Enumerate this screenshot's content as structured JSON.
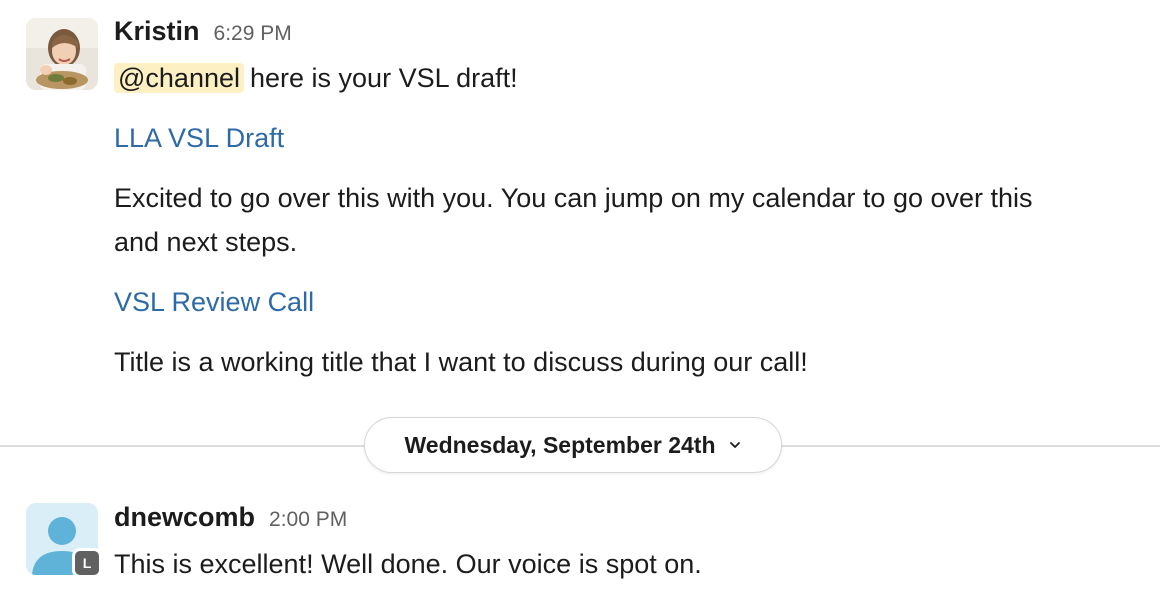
{
  "messages": [
    {
      "author": "Kristin",
      "time": "6:29 PM",
      "mention": "@channel",
      "intro": "here is your VSL draft!",
      "link1": "LLA VSL Draft",
      "body_line1": "Excited to go over this with you. You can jump on my calendar to go over this",
      "body_line2": "and next steps.",
      "link2": "VSL Review Call",
      "closing": "Title is a working title that I want to discuss during our call!"
    },
    {
      "author": "dnewcomb",
      "time": "2:00 PM",
      "badge": "L",
      "text": "This is excellent!  Well done.  Our voice is spot on."
    }
  ],
  "date_divider": {
    "label": "Wednesday, September 24th",
    "icon": "chevron-down-icon"
  },
  "colors": {
    "link": "#2d6aa6",
    "mention_bg": "#fdf1c4",
    "default_avatar_bg": "#d9eef7",
    "default_avatar_fg": "#5fb3d9"
  }
}
